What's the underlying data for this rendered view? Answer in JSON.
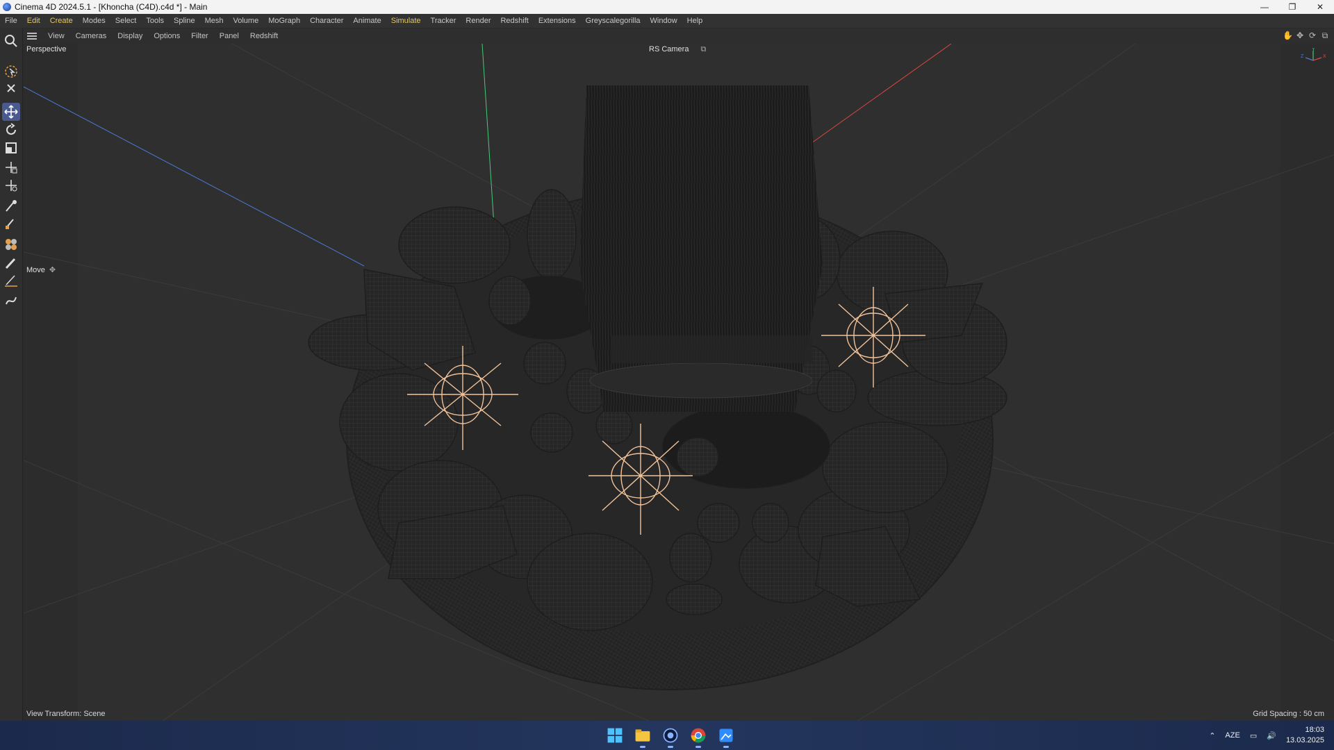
{
  "window": {
    "title": "Cinema 4D 2024.5.1 - [Khoncha (C4D).c4d *] - Main",
    "minimize": "—",
    "maximize": "❐",
    "close": "✕"
  },
  "menubar": {
    "items": [
      {
        "label": "File",
        "active": false
      },
      {
        "label": "Edit",
        "active": true
      },
      {
        "label": "Create",
        "active": true
      },
      {
        "label": "Modes",
        "active": false
      },
      {
        "label": "Select",
        "active": false
      },
      {
        "label": "Tools",
        "active": false
      },
      {
        "label": "Spline",
        "active": false
      },
      {
        "label": "Mesh",
        "active": false
      },
      {
        "label": "Volume",
        "active": false
      },
      {
        "label": "MoGraph",
        "active": false
      },
      {
        "label": "Character",
        "active": false
      },
      {
        "label": "Animate",
        "active": false
      },
      {
        "label": "Simulate",
        "active": true
      },
      {
        "label": "Tracker",
        "active": false
      },
      {
        "label": "Render",
        "active": false
      },
      {
        "label": "Redshift",
        "active": false
      },
      {
        "label": "Extensions",
        "active": false
      },
      {
        "label": "Greyscalegorilla",
        "active": false
      },
      {
        "label": "Window",
        "active": false
      },
      {
        "label": "Help",
        "active": false
      }
    ]
  },
  "viewport_menu": {
    "items": [
      "View",
      "Cameras",
      "Display",
      "Options",
      "Filter",
      "Panel",
      "Redshift"
    ]
  },
  "tools": [
    {
      "icon": "search-icon",
      "active": false
    },
    {
      "icon": "live-selection-icon",
      "active": false
    },
    {
      "icon": "tweak-icon",
      "active": false
    },
    {
      "icon": "move-icon",
      "active": true
    },
    {
      "icon": "rotate-icon",
      "active": false
    },
    {
      "icon": "scale-icon",
      "active": false
    },
    {
      "icon": "transform-icon",
      "active": false
    },
    {
      "icon": "multi-transform-icon",
      "active": false
    },
    {
      "icon": "brush-select-icon",
      "active": false
    },
    {
      "icon": "sculpt-icon",
      "active": false
    },
    {
      "icon": "material-icon",
      "active": false
    },
    {
      "icon": "paint-icon",
      "active": false
    },
    {
      "icon": "knife-icon",
      "active": false
    },
    {
      "icon": "spline-pen-icon",
      "active": false
    }
  ],
  "viewport": {
    "view_name": "Perspective",
    "camera_name": "RS Camera",
    "tool_name": "Move",
    "view_transform": "View Transform: Scene",
    "grid_spacing": "Grid Spacing : 50 cm",
    "axis_x": "X",
    "axis_y": "Y",
    "axis_z": "Z"
  },
  "colors": {
    "accent_active_tool": "#4a5a8f",
    "menu_highlight": "#e3c86a",
    "axis_x": "#e0483e",
    "axis_y": "#46c97a",
    "axis_z": "#4a7bd6",
    "light_gizmo": "#f2c39a"
  },
  "taskbar": {
    "apps": [
      {
        "icon": "windows-start-icon",
        "open": false
      },
      {
        "icon": "file-explorer-icon",
        "open": true
      },
      {
        "icon": "cinema4d-icon",
        "open": true
      },
      {
        "icon": "chrome-icon",
        "open": true
      },
      {
        "icon": "photos-app-icon",
        "open": true
      }
    ],
    "language": "AZE",
    "time": "18:03",
    "date": "13.03.2025"
  }
}
